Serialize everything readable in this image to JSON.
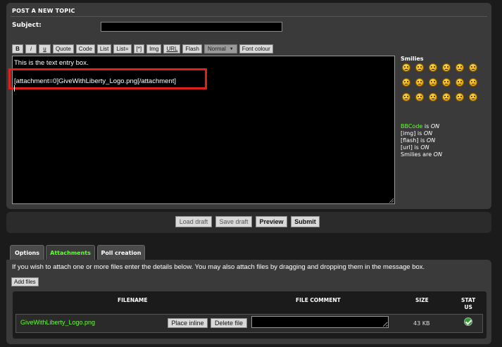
{
  "form": {
    "title": "POST A NEW TOPIC",
    "subject_label": "Subject:",
    "subject_value": ""
  },
  "toolbar": {
    "buttons": [
      "B",
      "i",
      "u",
      "Quote",
      "Code",
      "List",
      "List=",
      "[*]",
      "Img",
      "URL",
      "Flash"
    ],
    "font_size": {
      "selected": "Normal",
      "arrow": "▼"
    },
    "font_colour": "Font colour"
  },
  "editor": {
    "line1": "This is the text entry box.",
    "line2": "[attachment=0]GiveWithLiberty_Logo.png[/attachment]",
    "highlight_color": "#e0201c"
  },
  "smilies": {
    "title": "Smilies",
    "icons": [
      "smile-icon",
      "biggrin-icon",
      "grin-icon",
      "wink-icon",
      "surprised-icon",
      "eek-icon",
      "sad-icon",
      "mad-icon",
      "cool-icon",
      "lol-icon",
      "razz-icon",
      "twisted-icon",
      "redface-icon",
      "cry-icon",
      "evil-icon",
      "rolleyes-icon",
      "alien-icon",
      "geek-icon"
    ]
  },
  "status": {
    "bbcode_label": "BBCode",
    "bbcode_state": "ON",
    "img_label": "[img]",
    "img_state": "ON",
    "flash_label": "[flash]",
    "flash_state": "ON",
    "url_label": "[url]",
    "url_state": "ON",
    "smilies_label": "Smilies are",
    "smilies_state": "ON",
    "is_word": "is"
  },
  "actions": {
    "load_draft": "Load draft",
    "save_draft": "Save draft",
    "preview": "Preview",
    "submit": "Submit"
  },
  "tabs": {
    "options": "Options",
    "attachments": "Attachments",
    "poll": "Poll creation",
    "active_color": "#66ff33"
  },
  "attachments": {
    "info": "If you wish to attach one or more files enter the details below. You may also attach files by dragging and dropping them in the message box.",
    "add_files": "Add files",
    "headers": {
      "filename": "FILENAME",
      "comment": "FILE COMMENT",
      "size": "SIZE",
      "status_line1": "STAT",
      "status_line2": "US"
    },
    "rows": [
      {
        "filename": "GiveWithLiberty_Logo.png",
        "place_inline": "Place inline",
        "delete_file": "Delete file",
        "comment": "",
        "size": "43 KB",
        "status_icon": "check-icon"
      }
    ]
  }
}
